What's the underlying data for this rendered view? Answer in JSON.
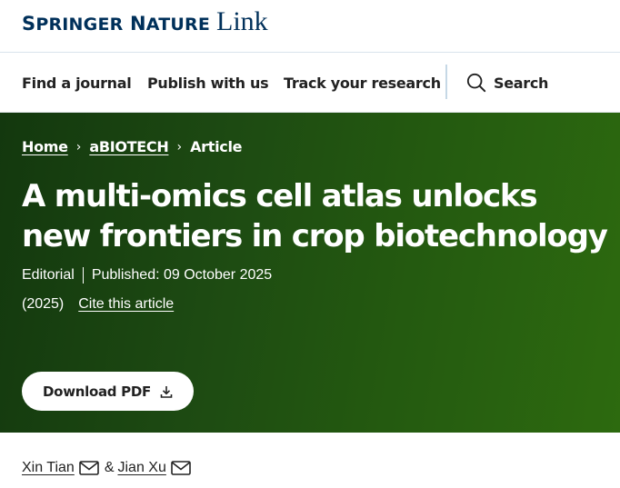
{
  "brand": {
    "part1_big": "S",
    "part1_small": "PRINGER",
    "part2_big": "N",
    "part2_small": "ATURE",
    "link_word": "Link",
    "color": "#00305a"
  },
  "nav": {
    "items": [
      {
        "label": "Find a journal"
      },
      {
        "label": "Publish with us"
      },
      {
        "label": "Track your research"
      }
    ],
    "search_label": "Search",
    "search_icon": "search-icon"
  },
  "breadcrumb": {
    "home": "Home",
    "journal": "aBIOTECH",
    "current": "Article",
    "separator": "›"
  },
  "article": {
    "title": "A multi-omics cell atlas unlocks new frontiers in crop biotechnology",
    "type": "Editorial",
    "published": "Published: 09 October 2025",
    "year": "(2025)",
    "cite_label": "Cite this article",
    "download_label": "Download PDF",
    "download_icon": "download-icon"
  },
  "authors": {
    "first": "Xin Tian",
    "amp": "&",
    "second": "Jian Xu",
    "mail_icon": "mail-icon"
  },
  "colors": {
    "hero_start": "#13380e",
    "hero_end": "#2d6a0f",
    "nav_separator": "#c6d8e6"
  }
}
